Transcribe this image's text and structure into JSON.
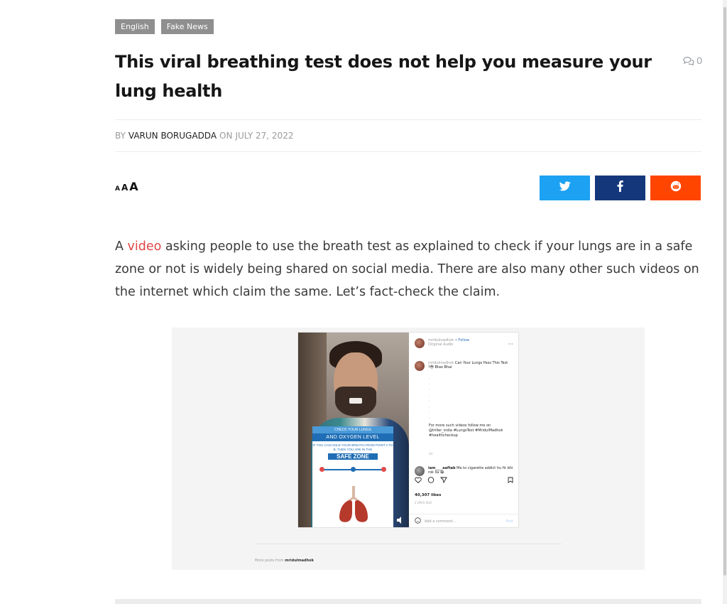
{
  "tags": [
    "English",
    "Fake News"
  ],
  "article": {
    "title": "This viral breathing test does not help you measure your lung health",
    "comment_count": "0",
    "meta": {
      "by": "BY",
      "author": "VARUN BORUGADDA",
      "on": "ON",
      "date": "JULY 27, 2022"
    },
    "font_size_controls": [
      "A",
      "A",
      "A"
    ],
    "share": {
      "twitter_icon": "twitter-icon",
      "facebook_icon": "facebook-icon",
      "reddit_icon": "reddit-icon"
    },
    "body": {
      "prefix": "A ",
      "link": "video",
      "suffix": " asking people to use the breath test as explained to check if your lungs are in a safe zone or not is widely being shared on social media. There are also many other such videos on the internet which claim the same. Let’s fact-check the claim."
    }
  },
  "embed": {
    "video_card": {
      "line1": "CHECK YOUR LUNGS",
      "line2": "AND OXYGEN LEVEL",
      "line3": "IF YOU CAN HOLD YOUR BREATH FROM POINT A TO B, THEN YOU ARE IN THE",
      "line4": "SAFE ZONE"
    },
    "header_user": "mridulmadhok",
    "follow": "• Follow",
    "audio": "Original Audio",
    "more_icon": "ellipsis-icon",
    "caption_user": "mridulmadhok",
    "caption": "Can Your Lungs Pass This Test ?😳 Btao Bhai",
    "caption_more": "For more such videos follow me on @triller_india #LungsTest #MridulMadhok #healthcheckup",
    "caption_age": "2d",
    "comment_user": "iam____aaftab",
    "comment_text": "Me to cigarette addict hu fir bhi rok lia 😂",
    "likes": "40,307 likes",
    "days": "2 DAYS AGO",
    "add_comment": "Add a comment...",
    "post_button": "Post",
    "more_posts_prefix": "More posts from",
    "more_posts_user": "mridulmadhok"
  },
  "colors": {
    "twitter": "#1da1f2",
    "facebook": "#14377c",
    "reddit": "#ff4500",
    "link": "#e04545",
    "tag_bg": "#8f8f8f"
  }
}
